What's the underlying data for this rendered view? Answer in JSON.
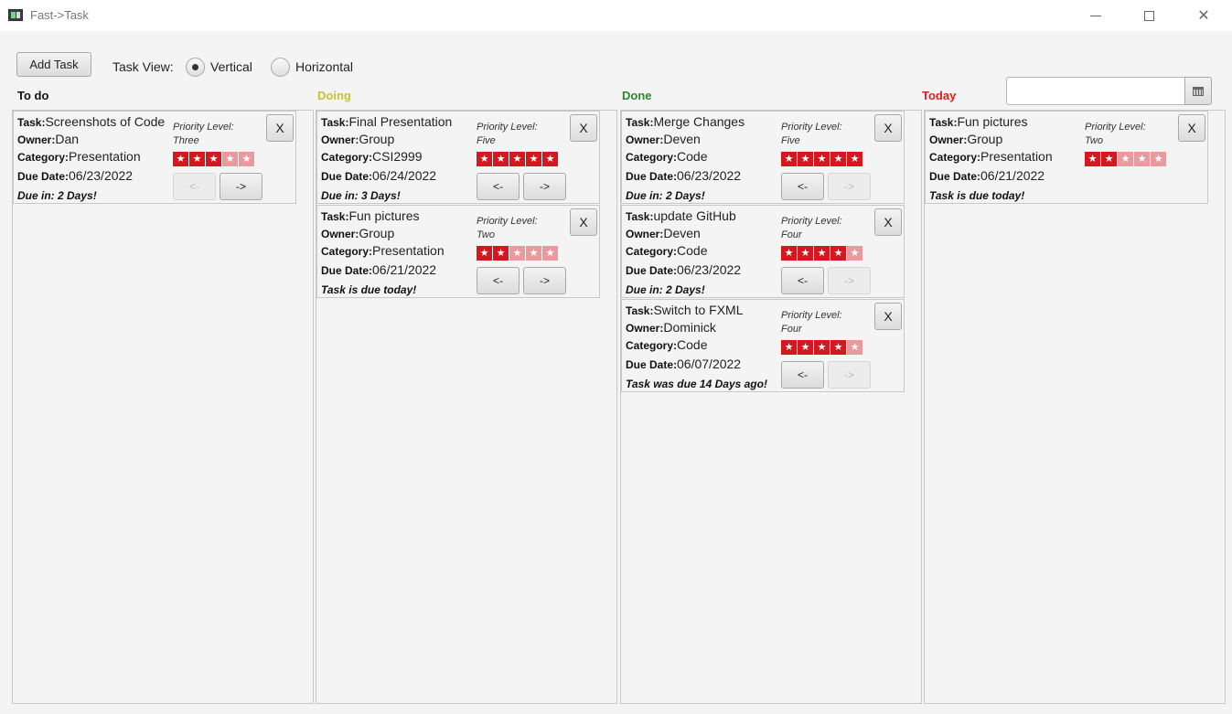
{
  "window": {
    "title": "Fast->Task",
    "minimize_glyph": "",
    "close_glyph": "✕"
  },
  "toolbar": {
    "add_task_label": "Add Task",
    "task_view_label": "Task View:",
    "view_options": [
      "Vertical",
      "Horizontal"
    ],
    "selected_view": "Vertical",
    "date_value": ""
  },
  "labels": {
    "task": "Task:",
    "owner": "Owner:",
    "category": "Category:",
    "due_date": "Due Date:",
    "priority": "Priority Level:",
    "delete": "X",
    "move_left": "<-",
    "move_right": "->"
  },
  "colors": {
    "todo": "#111111",
    "doing": "#c9c236",
    "done": "#2a8a2a",
    "today": "#e01c1c",
    "star_on": "#d51820",
    "star_off": "#e99a9f"
  },
  "columns": [
    {
      "key": "todo",
      "title": "To do",
      "tasks": [
        {
          "task": "Screenshots of Code",
          "owner": "Dan",
          "category": "Presentation",
          "due_date": "06/23/2022",
          "priority_text": "Three",
          "priority": 3,
          "due_text": "Due in: 2 Days!",
          "left_enabled": false,
          "right_enabled": true
        }
      ]
    },
    {
      "key": "doing",
      "title": "Doing",
      "tasks": [
        {
          "task": "Final Presentation",
          "owner": "Group",
          "category": "CSI2999",
          "due_date": "06/24/2022",
          "priority_text": "Five",
          "priority": 5,
          "due_text": "Due in: 3 Days!",
          "left_enabled": true,
          "right_enabled": true
        },
        {
          "task": "Fun pictures",
          "owner": "Group",
          "category": "Presentation",
          "due_date": "06/21/2022",
          "priority_text": "Two",
          "priority": 2,
          "due_text": "Task is due today!",
          "left_enabled": true,
          "right_enabled": true
        }
      ]
    },
    {
      "key": "done",
      "title": "Done",
      "tasks": [
        {
          "task": "Merge Changes",
          "owner": "Deven",
          "category": "Code",
          "due_date": "06/23/2022",
          "priority_text": "Five",
          "priority": 5,
          "due_text": "Due in: 2 Days!",
          "left_enabled": true,
          "right_enabled": false
        },
        {
          "task": "update GitHub",
          "owner": "Deven",
          "category": "Code",
          "due_date": "06/23/2022",
          "priority_text": "Four",
          "priority": 4,
          "due_text": "Due in: 2 Days!",
          "left_enabled": true,
          "right_enabled": false
        },
        {
          "task": "Switch to FXML",
          "owner": "Dominick",
          "category": "Code",
          "due_date": "06/07/2022",
          "priority_text": "Four",
          "priority": 4,
          "due_text": "Task was due 14 Days ago!",
          "left_enabled": true,
          "right_enabled": false
        }
      ]
    },
    {
      "key": "today",
      "title": "Today",
      "tasks": [
        {
          "task": "Fun pictures",
          "owner": "Group",
          "category": "Presentation",
          "due_date": "06/21/2022",
          "priority_text": "Two",
          "priority": 2,
          "due_text": "Task is due today!",
          "left_enabled": false,
          "right_enabled": false,
          "show_move": false
        }
      ]
    }
  ]
}
